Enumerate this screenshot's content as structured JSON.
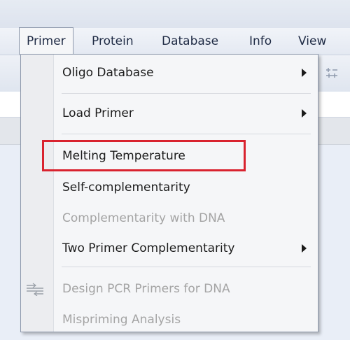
{
  "menubar": {
    "items": [
      {
        "label": "Primer",
        "active": true
      },
      {
        "label": "Protein"
      },
      {
        "label": "Database"
      },
      {
        "label": "Info"
      },
      {
        "label": "View"
      }
    ]
  },
  "dropdown": {
    "items": [
      {
        "label": "Oligo Database",
        "enabled": true,
        "submenu": true
      },
      {
        "label": "Load Primer",
        "enabled": true,
        "submenu": true
      },
      {
        "label": "Melting Temperature",
        "enabled": true,
        "highlighted": true
      },
      {
        "label": "Self-complementarity",
        "enabled": true
      },
      {
        "label": "Complementarity with DNA",
        "enabled": false
      },
      {
        "label": "Two Primer Complementarity",
        "enabled": true,
        "submenu": true
      },
      {
        "label": "Design PCR Primers for DNA",
        "enabled": false,
        "icon": "pcr-primers-icon"
      },
      {
        "label": "Mispriming Analysis",
        "enabled": false
      }
    ]
  },
  "colors": {
    "highlight_border": "#d9232f",
    "disabled_text": "#a4a4a4"
  }
}
